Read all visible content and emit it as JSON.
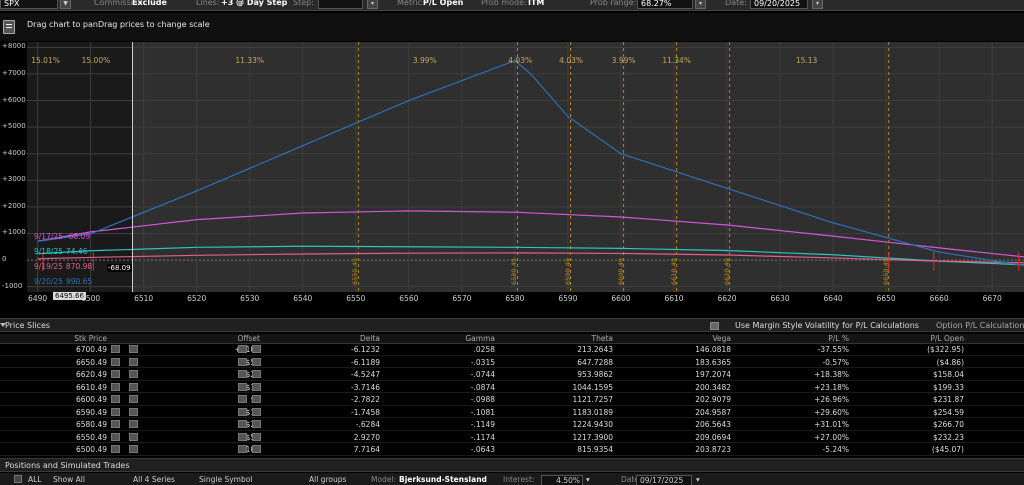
{
  "toolbar": {
    "symbol": "SPX",
    "commission_label": "Commission:",
    "commission_value": "Exclude",
    "lines_label": "Lines:",
    "lines_value": "+3 @ Day Step",
    "step_label": "Step:",
    "metric_label": "Metric:",
    "metric_value": "P/L Open",
    "prob_mode_label": "Prob mode:",
    "prob_mode_value": "ITM",
    "prob_range_label": "Prob range:",
    "prob_range_value": "68.27%",
    "date_label": "Date:",
    "date_value": "09/20/2025"
  },
  "hint": {
    "text": "Drag chart to panDrag prices to change scale"
  },
  "chart_data": {
    "type": "line",
    "y_ticks": [
      "+8000",
      "+7000",
      "+6000",
      "+5000",
      "+4000",
      "+3000",
      "+2000",
      "+1000",
      "0",
      "-1000"
    ],
    "x_ticks": [
      "6490",
      "6500",
      "6510",
      "6520",
      "6530",
      "6540",
      "6550",
      "6560",
      "6570",
      "6580",
      "6590",
      "6600",
      "6610",
      "6620",
      "6630",
      "6640",
      "6650",
      "6660",
      "6670"
    ],
    "xlim": [
      6488,
      6676
    ],
    "ylim": [
      -1200,
      8200
    ],
    "cursor_price": "6495.66",
    "cursor_pl": "-68.09",
    "prob_labels": [
      "15.01%",
      "15.00%",
      "11.33%",
      "3.99%",
      "4.03%",
      "4.03%",
      "3.99%",
      "11.34%",
      "15.13"
    ],
    "strike_lines": [
      "6550.49",
      "6580.49",
      "6590.49",
      "6600.49",
      "6610.49",
      "6620.49",
      "6650.49"
    ],
    "series": [
      {
        "name": "9/17/25",
        "value": "-68.09",
        "color": "#d455d4",
        "x": [
          6490,
          6500,
          6520,
          6540,
          6560,
          6580,
          6600,
          6620,
          6640,
          6660,
          6676
        ],
        "y": [
          710,
          1060,
          1520,
          1770,
          1850,
          1800,
          1620,
          1320,
          900,
          460,
          120
        ]
      },
      {
        "name": "9/18/25",
        "value": "74.46",
        "color": "#2ec4c4",
        "x": [
          6490,
          6500,
          6520,
          6540,
          6560,
          6580,
          6600,
          6620,
          6640,
          6660,
          6676
        ],
        "y": [
          240,
          350,
          480,
          520,
          500,
          480,
          440,
          360,
          200,
          -40,
          -180
        ]
      },
      {
        "name": "9/19/25",
        "value": "870.98",
        "color": "#e0608a",
        "x": [
          6490,
          6500,
          6520,
          6540,
          6560,
          6580,
          6600,
          6620,
          6640,
          6660,
          6676
        ],
        "y": [
          50,
          100,
          180,
          230,
          260,
          270,
          250,
          190,
          80,
          -40,
          -100
        ]
      },
      {
        "name": "9/20/25",
        "value": "990.65",
        "color": "#2f6fb8",
        "x": [
          6490,
          6500,
          6520,
          6540,
          6560,
          6580,
          6583,
          6590,
          6600,
          6620,
          6640,
          6660,
          6676
        ],
        "y": [
          700,
          990,
          2600,
          4300,
          6000,
          7500,
          7000,
          5400,
          4000,
          2700,
          1400,
          300,
          -200
        ]
      }
    ]
  },
  "slices": {
    "title": "Price Slices",
    "margin_label": "Use Margin Style Volatility for P/L Calculations",
    "option_label": "Option P/L Calculation",
    "headers": [
      "Stk Price",
      "Offset",
      "Delta",
      "Gamma",
      "Theta",
      "Vega",
      "P/L %",
      "P/L Open"
    ],
    "rows": [
      [
        "6700.49",
        "+$100",
        "-6.1232",
        ".0258",
        "213.2643",
        "146.0818",
        "-37.55%",
        "($322.95)"
      ],
      [
        "6650.49",
        "+$50",
        "-6.1189",
        "-.0315",
        "647.7288",
        "183.6365",
        "-0.57%",
        "($4.86)"
      ],
      [
        "6620.49",
        "+$20",
        "-4.5247",
        "-.0744",
        "953.9862",
        "197.2074",
        "+18.38%",
        "$158.04"
      ],
      [
        "6610.49",
        "+$10",
        "-3.7146",
        "-.0874",
        "1044.1595",
        "200.3482",
        "+23.18%",
        "$199.33"
      ],
      [
        "6600.49",
        "$0",
        "-2.7822",
        "-.0988",
        "1121.7257",
        "202.9079",
        "+26.96%",
        "$231.87"
      ],
      [
        "6590.49",
        "-$10",
        "-1.7458",
        "-.1081",
        "1183.0189",
        "204.9587",
        "+29.60%",
        "$254.59"
      ],
      [
        "6580.49",
        "-$20",
        "-.6284",
        "-.1149",
        "1224.9430",
        "206.5643",
        "+31.01%",
        "$266.70"
      ],
      [
        "6550.49",
        "-$50",
        "2.9270",
        "-.1174",
        "1217.3900",
        "209.0694",
        "+27.00%",
        "$232.23"
      ],
      [
        "6500.49",
        "-$100",
        "7.7164",
        "-.0643",
        "815.9354",
        "203.8723",
        "-5.24%",
        "($45.07)"
      ]
    ]
  },
  "positions": {
    "title": "Positions and Simulated Trades"
  },
  "bottom": {
    "all": "ALL",
    "show": "Show All",
    "series": "All 4 Series",
    "symbol": "Single Symbol",
    "groups": "All groups",
    "model_label": "Model:",
    "model": "Bjerksund-Stensland",
    "interest_label": "Interest:",
    "interest": "4.50%",
    "date_label": "Date:",
    "date": "09/17/2025"
  }
}
